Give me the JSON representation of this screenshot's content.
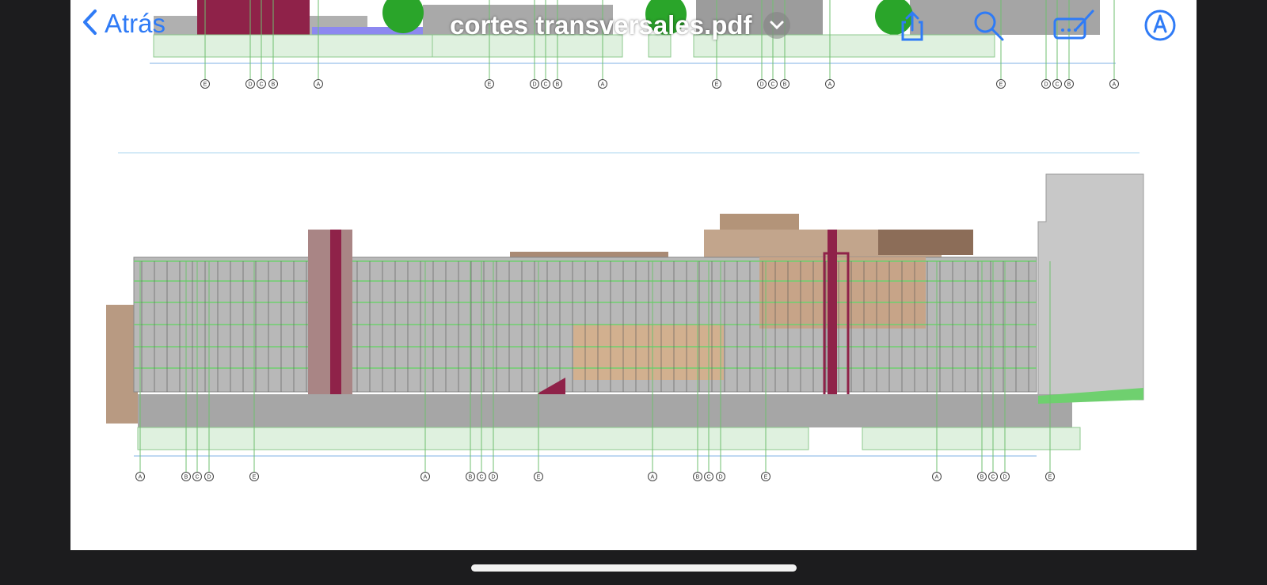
{
  "app": {
    "back_label": "Atrás",
    "document_title": "cortes transversales.pdf"
  },
  "icons": {
    "back": "chevron-left-icon",
    "title_menu": "chevron-down-icon",
    "share": "share-icon",
    "search": "search-icon",
    "markup_tools": "marker-toolbox-icon",
    "annotate": "pen-circle-icon"
  },
  "colors": {
    "accent": "#2f7bf6",
    "page_background": "#ffffff",
    "chrome_background": "#1c1c1e"
  },
  "drawing": {
    "axis_labels_top": [
      "E",
      "D",
      "C",
      "B",
      "A",
      "E",
      "D",
      "C",
      "B",
      "A",
      "E",
      "D",
      "C",
      "B",
      "A",
      "E",
      "D",
      "C",
      "B",
      "A"
    ],
    "axis_labels_bottom": [
      "A",
      "B",
      "C",
      "D",
      "E",
      "A",
      "B",
      "C",
      "D",
      "E",
      "A",
      "B",
      "C",
      "D",
      "E",
      "A",
      "B",
      "C",
      "D",
      "E"
    ]
  }
}
